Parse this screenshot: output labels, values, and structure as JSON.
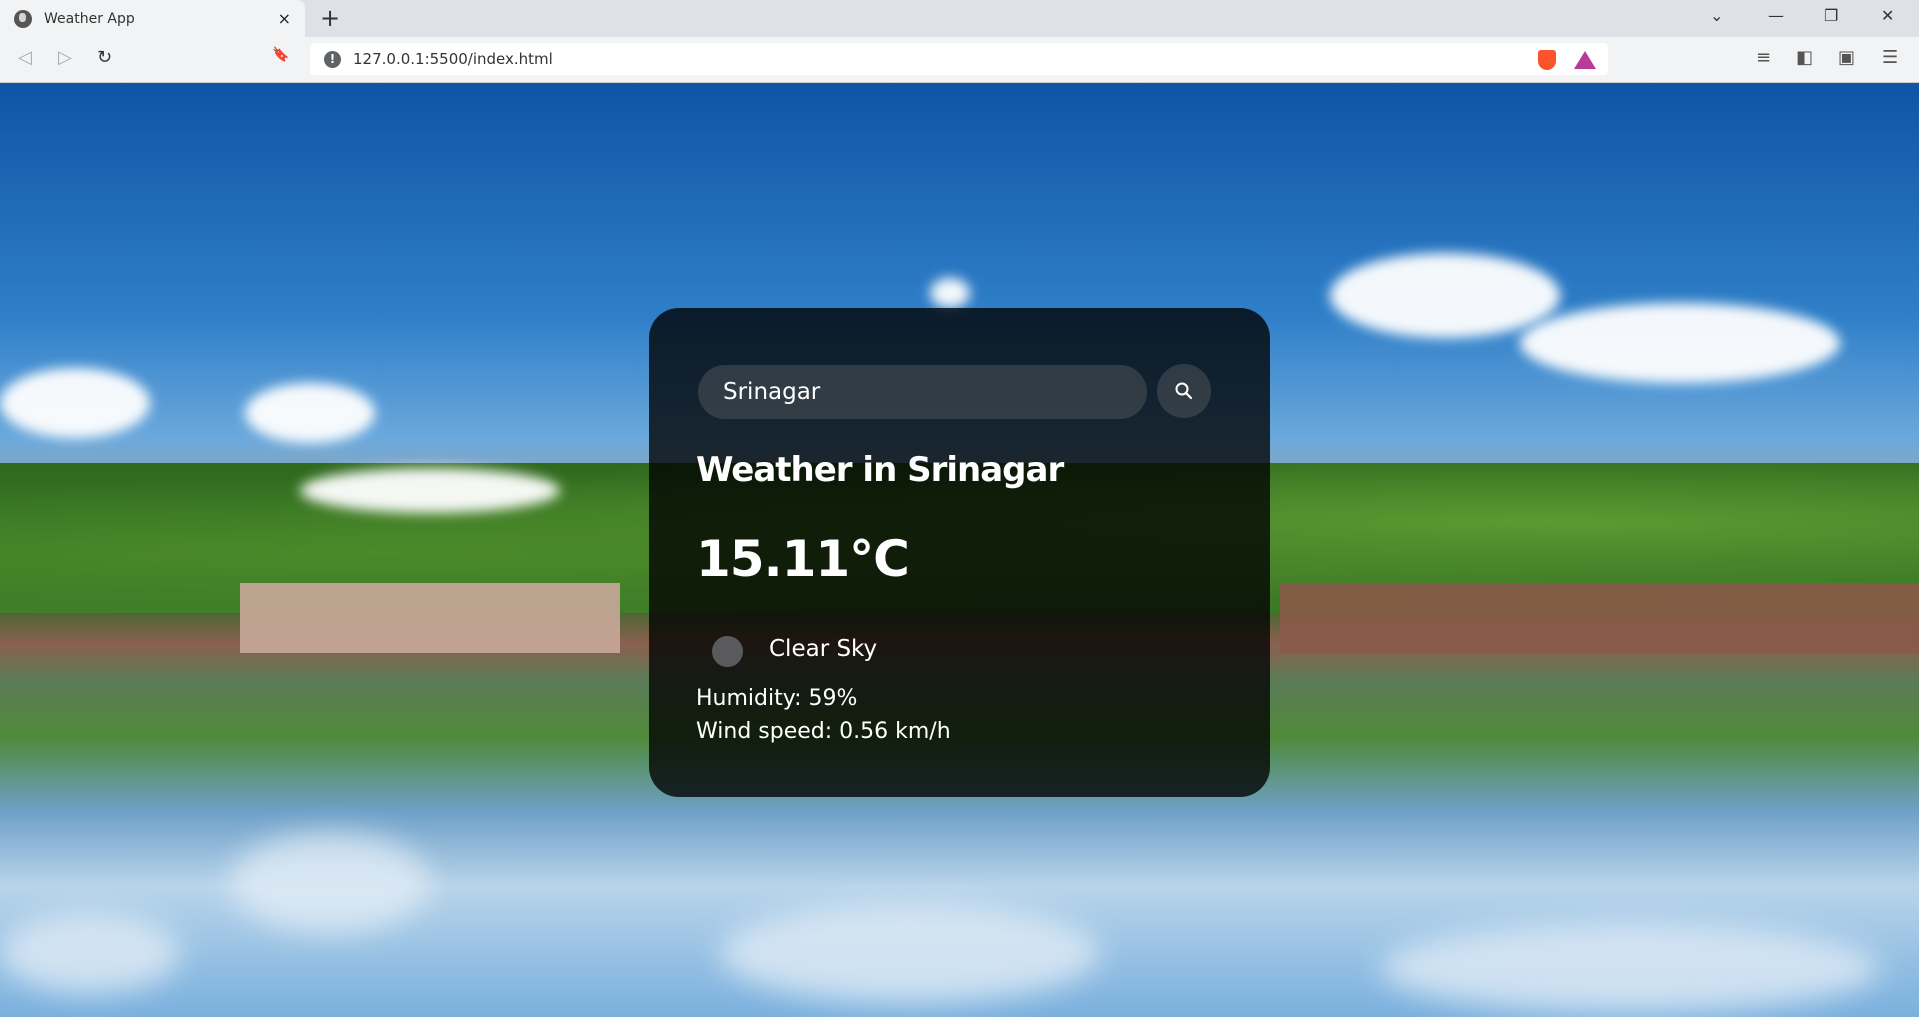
{
  "browser": {
    "tab_title": "Weather App",
    "tab_close": "×",
    "new_tab": "+",
    "url": "127.0.0.1:5500/index.html",
    "info_icon": "!",
    "controls": {
      "back": "◁",
      "forward": "▷",
      "reload": "↻",
      "bookmark": "🔖",
      "chevron": "⌄",
      "minimize": "—",
      "restore": "❐",
      "close": "✕",
      "playlist": "≡",
      "sidebar": "◧",
      "wallet": "▣",
      "menu": "☰"
    }
  },
  "weather": {
    "search_value": "Srinagar",
    "search_icon": "search-icon",
    "heading": "Weather in Srinagar",
    "temperature": "15.11°C",
    "condition_icon": "clear-sky-icon",
    "description": "Clear Sky",
    "humidity": "Humidity: 59%",
    "wind": "Wind speed: 0.56 km/h"
  }
}
